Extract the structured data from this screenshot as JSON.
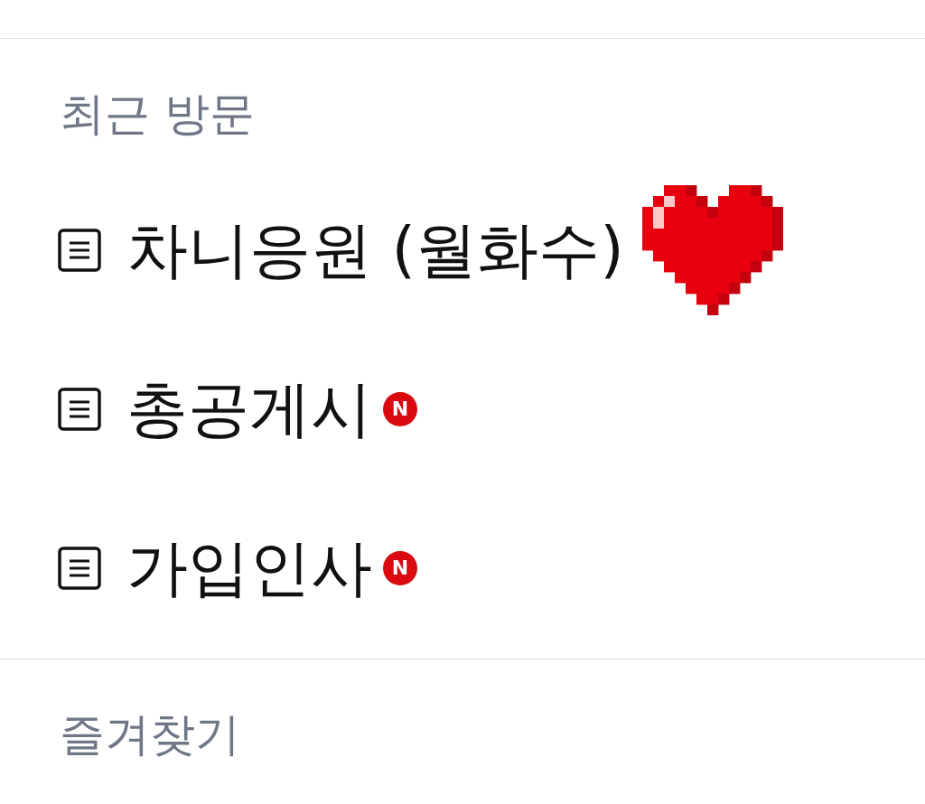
{
  "sections": [
    {
      "title": "최근 방문",
      "items": [
        {
          "label": "차니응원 (월화수)",
          "trailing_icon": true
        },
        {
          "label": "총공게시",
          "badge": "N"
        },
        {
          "label": "가입인사",
          "badge": "N"
        }
      ]
    },
    {
      "title": "즐겨찾기"
    }
  ]
}
